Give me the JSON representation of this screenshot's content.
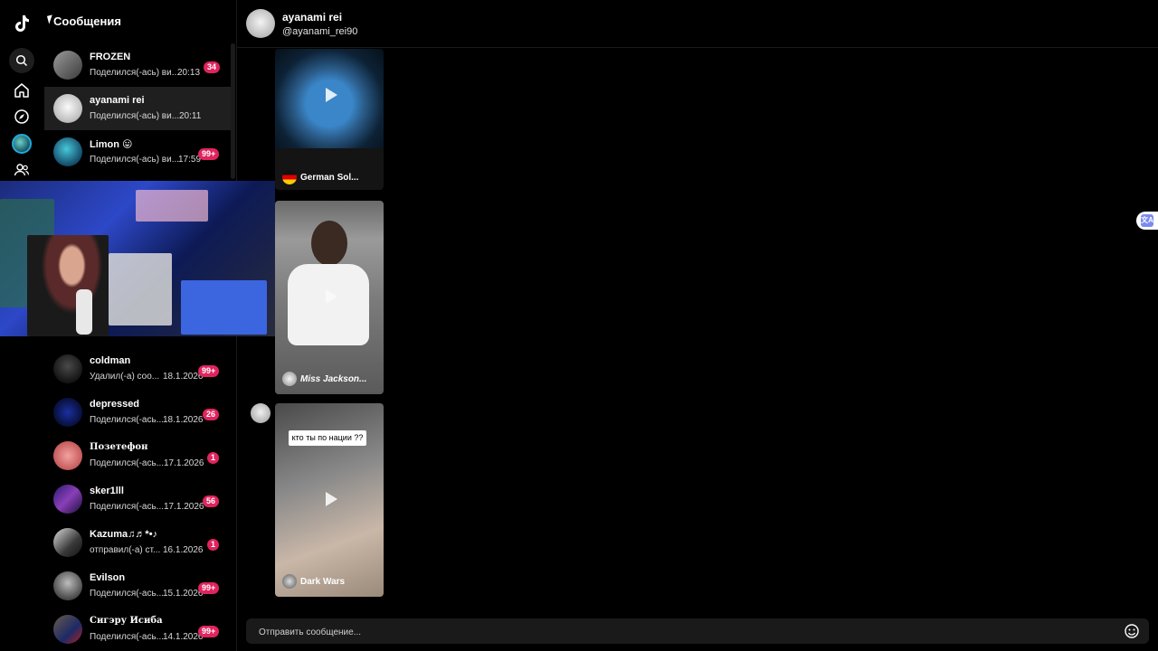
{
  "sidebar_title": "Сообщения",
  "conversations": [
    {
      "name": "FROZEN",
      "preview": "Поделился(-ась) ви...",
      "time": "20:13",
      "badge": "34"
    },
    {
      "name": "ayanami rei",
      "preview": "Поделился(-ась) ви...",
      "time": "20:11",
      "badge": ""
    },
    {
      "name": "Limon 😛",
      "preview": "Поделился(-ась) ви...",
      "time": "17:59",
      "badge": "99+"
    },
    {
      "name": "coldman",
      "preview": "Удалил(-а) соо...",
      "time": "18.1.2026",
      "badge": "99+"
    },
    {
      "name": "depressed",
      "preview": "Поделился(-ась...",
      "time": "18.1.2026",
      "badge": "26"
    },
    {
      "name": "Позетефон",
      "preview": "Поделился(-ась...",
      "time": "17.1.2026",
      "badge": "1"
    },
    {
      "name": "sker1lll",
      "preview": "Поделился(-ась...",
      "time": "17.1.2026",
      "badge": "56"
    },
    {
      "name": "Kazuma♫♬*•♪",
      "preview": "отправил(-а) ст...",
      "time": "16.1.2026",
      "badge": "1"
    },
    {
      "name": "Evilson",
      "preview": "Поделился(-ась...",
      "time": "15.1.2026",
      "badge": "99+"
    },
    {
      "name": "Сигэру Исиба",
      "preview": "Поделился(-ась...",
      "time": "14.1.2026",
      "badge": "99+"
    }
  ],
  "chat": {
    "title": "ayanami rei",
    "handle": "@ayanami_rei90"
  },
  "messages": [
    {
      "caption": "German Sol..."
    },
    {
      "caption": "Miss Jackson..."
    },
    {
      "overlay_text": "кто ты по нации ??",
      "caption": "Dark Wars"
    }
  ],
  "composer": {
    "placeholder": "Отправить сообщение..."
  },
  "icons": {
    "rail": [
      "tiktok-logo-icon",
      "search-icon",
      "home-icon",
      "explore-icon",
      "globe-avatar-icon",
      "friends-icon"
    ],
    "composer": "emoji-icon",
    "translate": "translate-icon"
  },
  "colors": {
    "background": "#000000",
    "active_row": "#1f1f1f",
    "badge": "#e0245e",
    "composer_bg": "#1a1a1a"
  }
}
